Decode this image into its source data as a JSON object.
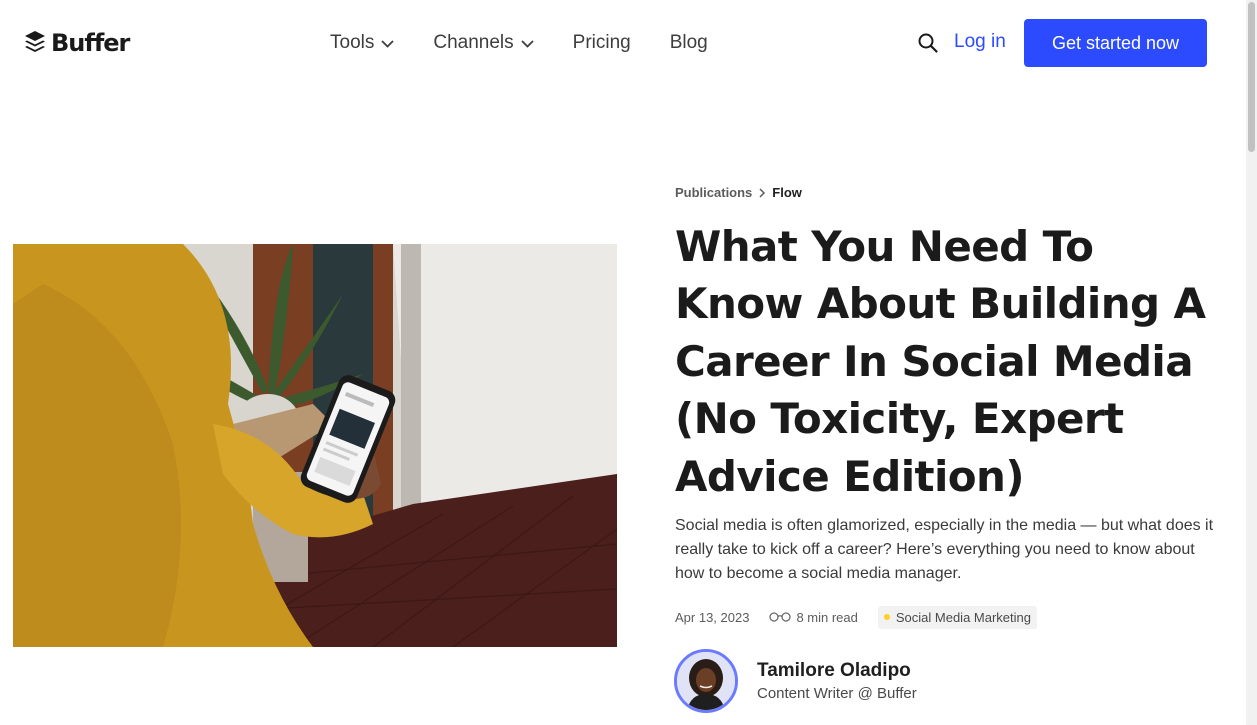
{
  "header": {
    "logo_text": "Buffer",
    "nav": [
      {
        "label": "Tools",
        "has_dropdown": true
      },
      {
        "label": "Channels",
        "has_dropdown": true
      },
      {
        "label": "Pricing",
        "has_dropdown": false
      },
      {
        "label": "Blog",
        "has_dropdown": false
      }
    ],
    "search_icon": "search-icon",
    "login_label": "Log in",
    "cta_label": "Get started now"
  },
  "article": {
    "breadcrumb": [
      "Publications",
      "Flow"
    ],
    "title": "What You Need To Know About Building A Career In Social Media (No Toxicity, Expert Advice Edition)",
    "summary": "Social media is often glamorized, especially in the media — but what does it really take to kick off a career? Here’s everything you need to know about how to become a social media manager.",
    "date": "Apr 13, 2023",
    "read_time": "8 min read",
    "tag": "Social Media Marketing",
    "author": {
      "name": "Tamilore Oladipo",
      "role": "Content Writer @ Buffer"
    }
  },
  "colors": {
    "accent": "#2c4bff",
    "tag_dot": "#ffcf26",
    "avatar_ring": "#6b7bff"
  }
}
